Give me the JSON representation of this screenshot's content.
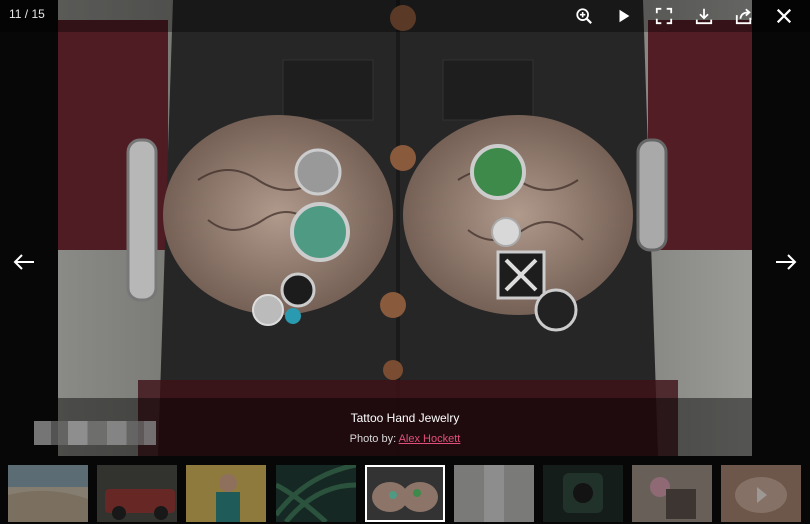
{
  "counter": {
    "current": "11",
    "total": "15",
    "text": "11 / 15"
  },
  "toolbar": {
    "buttons": [
      {
        "icon": "zoom-in-icon"
      },
      {
        "icon": "play-icon"
      },
      {
        "icon": "fullscreen-icon"
      },
      {
        "icon": "download-icon"
      },
      {
        "icon": "share-icon"
      },
      {
        "icon": "close-icon"
      }
    ]
  },
  "navigation": {
    "prev_icon": "arrow-left-icon",
    "next_icon": "arrow-right-icon"
  },
  "caption": {
    "title": "Tattoo Hand Jewelry",
    "credit_prefix": "Photo by:",
    "credit_name": "Alex Hockett"
  },
  "thumbnails": {
    "count": 9,
    "active_index": 4
  },
  "colors": {
    "accent_link": "#e0507a",
    "background": "#070707"
  }
}
